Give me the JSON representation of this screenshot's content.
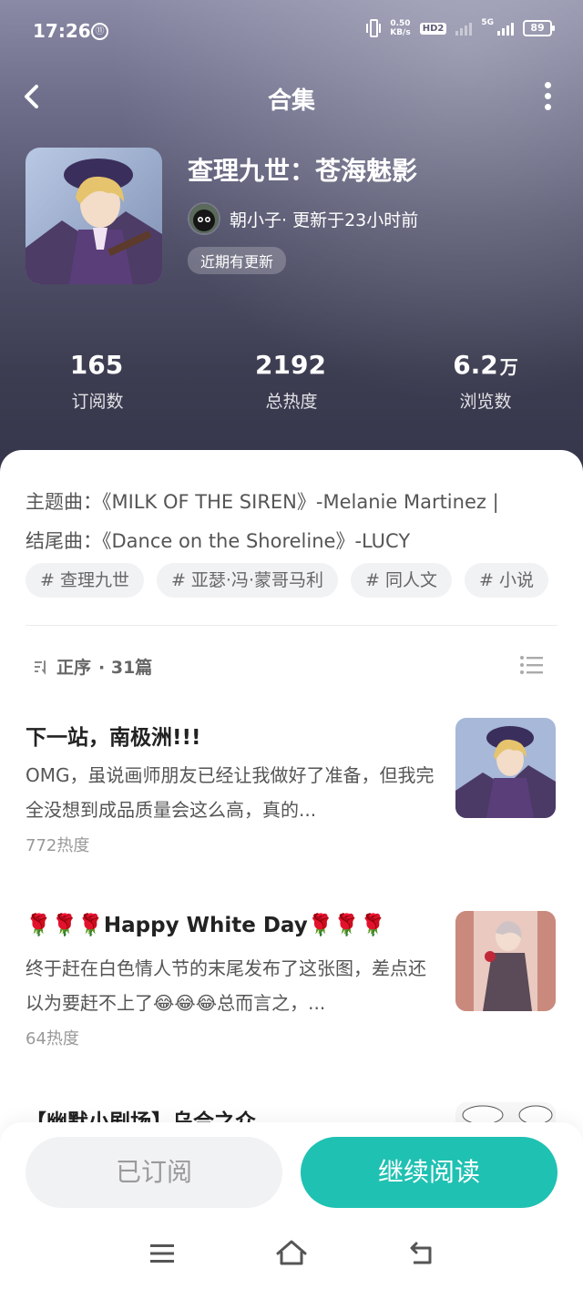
{
  "status_bar": {
    "time": "17:26",
    "circle_icon_text": "⑪",
    "net_speed_value": "0.50",
    "net_speed_unit": "KB/s",
    "hd_label": "HD2",
    "network_label": "5G",
    "battery": "89"
  },
  "header": {
    "title": "合集",
    "back_icon": "chevron-left-icon",
    "more_icon": "more-vertical-icon"
  },
  "collection": {
    "title": "查理九世：苍海魅影",
    "author_line": "朝小子· 更新于23小时前",
    "update_badge": "近期有更新"
  },
  "stats": [
    {
      "value": "165",
      "unit": "",
      "label": "订阅数"
    },
    {
      "value": "2192",
      "unit": "",
      "label": "总热度"
    },
    {
      "value": "6.2",
      "unit": "万",
      "label": "浏览数"
    }
  ],
  "description": {
    "line1": "主题曲：《MILK OF THE SIREN》-Melanie Martinez |",
    "line2": "结尾曲：《Dance on the Shoreline》-LUCY"
  },
  "tags": [
    "# 查理九世",
    "# 亚瑟·冯·蒙哥马利",
    "# 同人文",
    "# 小说"
  ],
  "sort": {
    "label": "正序",
    "count": "· 31篇"
  },
  "chapters": [
    {
      "title": "下一站，南极洲!!!",
      "summary": "OMG，虽说画师朋友已经让我做好了准备，但我完全没想到成品质量会这么高，真的...",
      "heat": "772热度"
    },
    {
      "title": "🌹🌹🌹Happy White Day🌹🌹🌹",
      "summary": "终于赶在白色情人节的末尾发布了这张图，差点还以为要赶不上了😂😂😂总而言之，...",
      "heat": "64热度"
    },
    {
      "title": "【幽默小剧场】乌合之众",
      "summary": "",
      "heat": ""
    }
  ],
  "actions": {
    "subscribed": "已订阅",
    "continue": "继续阅读"
  },
  "colors": {
    "accent": "#1fc1b2",
    "tag_bg": "#f1f2f4"
  }
}
